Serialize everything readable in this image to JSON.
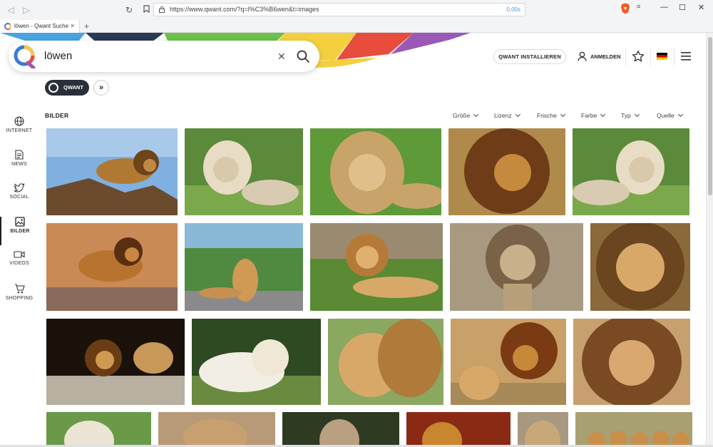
{
  "browser": {
    "url": "https://www.qwant.com/?q=l%C3%B6wen&t=images",
    "load_time": "0.00s",
    "tab_title": "löwen - Qwant Suche"
  },
  "search": {
    "query": "löwen"
  },
  "header": {
    "install_label": "QWANT INSTALLIEREN",
    "login_label": "ANMELDEN"
  },
  "engine_button": {
    "label": "QWANT"
  },
  "sidebar": {
    "items": [
      {
        "label": "INTERNET",
        "icon": "globe-icon"
      },
      {
        "label": "NEWS",
        "icon": "document-icon"
      },
      {
        "label": "SOCIAL",
        "icon": "twitter-icon"
      },
      {
        "label": "BILDER",
        "icon": "image-icon"
      },
      {
        "label": "VIDEOS",
        "icon": "video-icon"
      },
      {
        "label": "SHOPPING",
        "icon": "cart-icon"
      }
    ]
  },
  "results": {
    "section_title": "BILDER",
    "filters": [
      "Größe",
      "Lizenz",
      "Frische",
      "Farbe",
      "Typ",
      "Quelle"
    ]
  },
  "colors": {
    "accent_dark": "#2b2f3a",
    "link_blue": "#4c8cf5"
  }
}
